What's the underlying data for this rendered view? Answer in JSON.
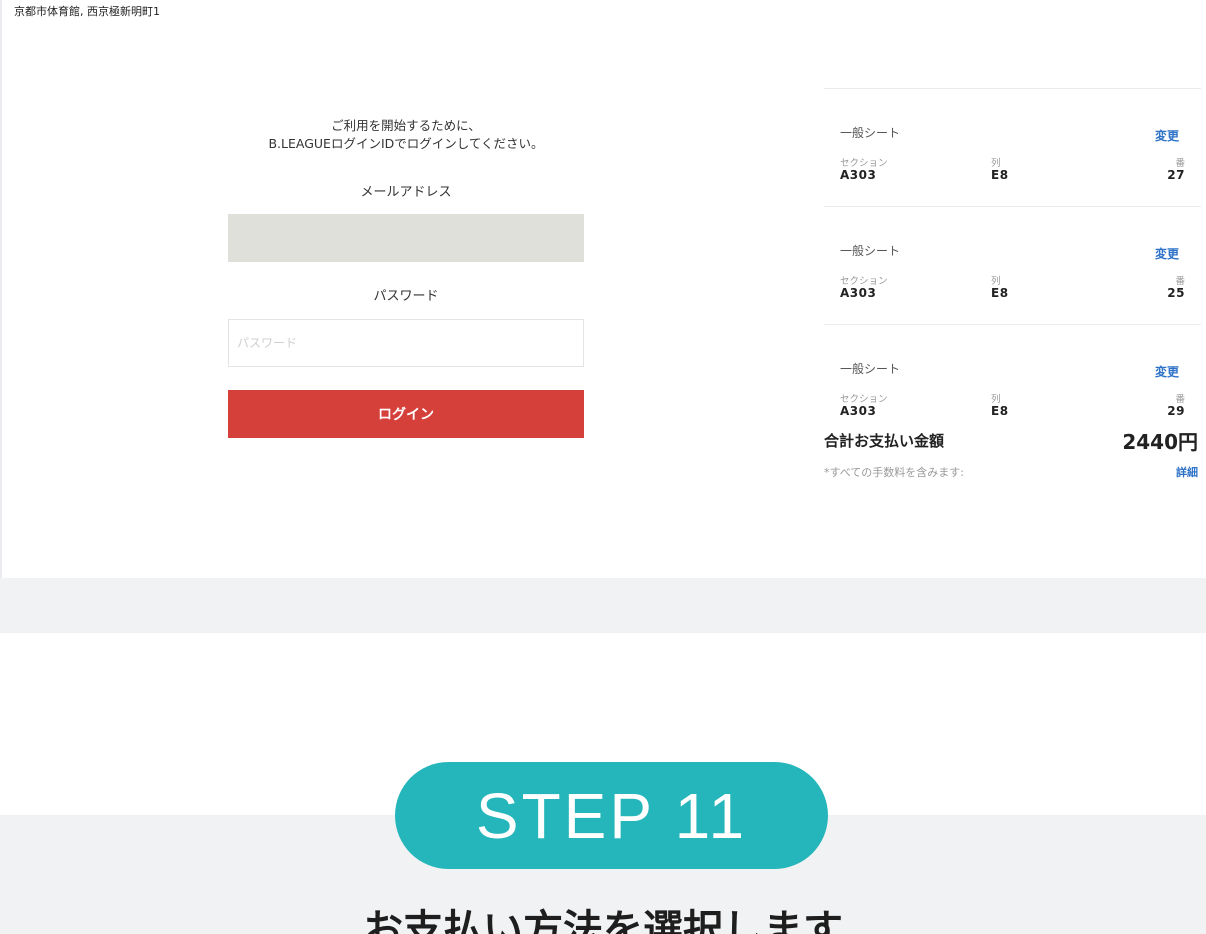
{
  "venue": "京都市体育館, 西京極新明町1",
  "login": {
    "intro_line1": "ご利用を開始するために、",
    "intro_line2": "B.LEAGUEログインIDでログインしてください。",
    "email_label": "メールアドレス",
    "email_value": "",
    "password_label": "パスワード",
    "password_placeholder": "パスワード",
    "login_button": "ログイン"
  },
  "seats": [
    {
      "type": "一般シート",
      "change": "変更",
      "section_label": "セクション",
      "section": "A303",
      "row_label": "列",
      "row": "E8",
      "number_label": "番",
      "number": "27"
    },
    {
      "type": "一般シート",
      "change": "変更",
      "section_label": "セクション",
      "section": "A303",
      "row_label": "列",
      "row": "E8",
      "number_label": "番",
      "number": "25"
    },
    {
      "type": "一般シート",
      "change": "変更",
      "section_label": "セクション",
      "section": "A303",
      "row_label": "列",
      "row": "E8",
      "number_label": "番",
      "number": "29"
    }
  ],
  "summary": {
    "total_label": "合計お支払い金額",
    "total_amount": "2440円",
    "tax_note": "*すべての手数料を含みます:",
    "details_link": "詳細"
  },
  "step": {
    "label": "STEP 11",
    "heading": "お支払い方法を選択します"
  },
  "colors": {
    "accent_red": "#d5403b",
    "link_blue": "#2f73c8",
    "step_teal": "#24b6ba",
    "band_gray": "#f1f2f3"
  }
}
